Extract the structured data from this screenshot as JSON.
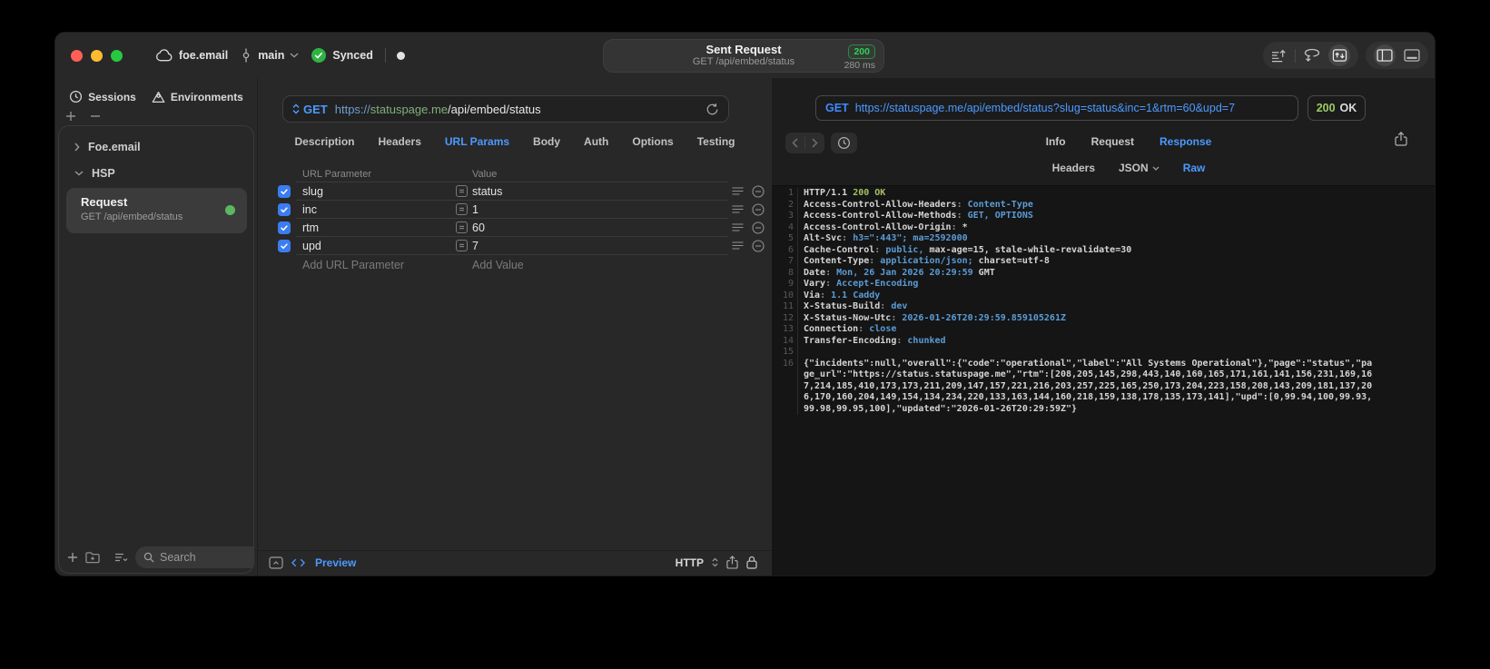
{
  "titlebar": {
    "project": "foe.email",
    "branch": "main",
    "sync_status": "Synced",
    "request_title": "Sent Request",
    "request_subtitle": "GET /api/embed/status",
    "status_code": "200",
    "duration": "280 ms"
  },
  "sidebar": {
    "tabs": [
      {
        "label": "Sessions"
      },
      {
        "label": "Environments"
      }
    ],
    "tree": [
      {
        "label": "Foe.email"
      },
      {
        "label": "HSP"
      }
    ],
    "request_item": {
      "title": "Request",
      "subtitle": "GET /api/embed/status"
    },
    "search_placeholder": "Search"
  },
  "request": {
    "method": "GET",
    "url": {
      "scheme": "https://",
      "host": "statuspage.me",
      "path": "/api/embed/status"
    },
    "tabs": [
      "Description",
      "Headers",
      "URL Params",
      "Body",
      "Auth",
      "Options",
      "Testing"
    ],
    "active_tab": "URL Params",
    "params": {
      "columns": [
        "URL Parameter",
        "Value"
      ],
      "rows": [
        {
          "enabled": true,
          "name": "slug",
          "value": "status"
        },
        {
          "enabled": true,
          "name": "inc",
          "value": "1"
        },
        {
          "enabled": true,
          "name": "rtm",
          "value": "60"
        },
        {
          "enabled": true,
          "name": "upd",
          "value": "7"
        }
      ],
      "add_name_placeholder": "Add URL Parameter",
      "add_value_placeholder": "Add Value"
    },
    "footer": {
      "preview_label": "Preview",
      "protocol_label": "HTTP"
    }
  },
  "response": {
    "method": "GET",
    "url": "https://statuspage.me/api/embed/status?slug=status&inc=1&rtm=60&upd=7",
    "status_code": "200",
    "status_text": "OK",
    "tabs": [
      "Info",
      "Request",
      "Response"
    ],
    "active_tab": "Response",
    "view_tabs": [
      "Headers",
      "JSON",
      "Raw"
    ],
    "active_view_tab": "Raw",
    "lines": [
      {
        "n": "1",
        "name": "HTTP/1.1",
        "sep": " ",
        "status": "200 OK"
      },
      {
        "n": "2",
        "name": "Access-Control-Allow-Headers",
        "sep": ": ",
        "value": "Content-Type"
      },
      {
        "n": "3",
        "name": "Access-Control-Allow-Methods",
        "sep": ": ",
        "value": "GET, OPTIONS"
      },
      {
        "n": "4",
        "name": "Access-Control-Allow-Origin",
        "sep": ": ",
        "rest": "*"
      },
      {
        "n": "5",
        "name": "Alt-Svc",
        "sep": ": ",
        "value": "h3=\":443\"; ma=2592000"
      },
      {
        "n": "6",
        "name": "Cache-Control",
        "sep": ": ",
        "value": "public,",
        "rest": " max-age=15, stale-while-revalidate=30"
      },
      {
        "n": "7",
        "name": "Content-Type",
        "sep": ": ",
        "value": "application/json;",
        "rest": " charset=utf-8"
      },
      {
        "n": "8",
        "name": "Date",
        "sep": ": ",
        "value": "Mon, 26 Jan 2026 20:29:59",
        "rest": " GMT"
      },
      {
        "n": "9",
        "name": "Vary",
        "sep": ": ",
        "value": "Accept-Encoding"
      },
      {
        "n": "10",
        "name": "Via",
        "sep": ": ",
        "value": "1.1 Caddy"
      },
      {
        "n": "11",
        "name": "X-Status-Build",
        "sep": ": ",
        "value": "dev"
      },
      {
        "n": "12",
        "name": "X-Status-Now-Utc",
        "sep": ": ",
        "value": "2026-01-26T20:29:59.859105261Z"
      },
      {
        "n": "13",
        "name": "Connection",
        "sep": ": ",
        "value": "close"
      },
      {
        "n": "14",
        "name": "Transfer-Encoding",
        "sep": ": ",
        "value": "chunked"
      },
      {
        "n": "15"
      },
      {
        "n": "16",
        "body": "{\"incidents\":null,\"overall\":{\"code\":\"operational\",\"label\":\"All Systems Operational\"},\"page\":\"status\",\"page_url\":\"https://status.statuspage.me\",\"rtm\":[208,205,145,298,443,140,160,165,171,161,141,156,231,169,167,214,185,410,173,173,211,209,147,157,221,216,203,257,225,165,250,173,204,223,158,208,143,209,181,137,206,170,160,204,149,154,134,234,220,133,163,144,160,218,159,138,178,135,173,141],\"upd\":[0,99.94,100,99.93,99.98,99.95,100],\"updated\":\"2026-01-26T20:29:59Z\"}"
      }
    ]
  }
}
